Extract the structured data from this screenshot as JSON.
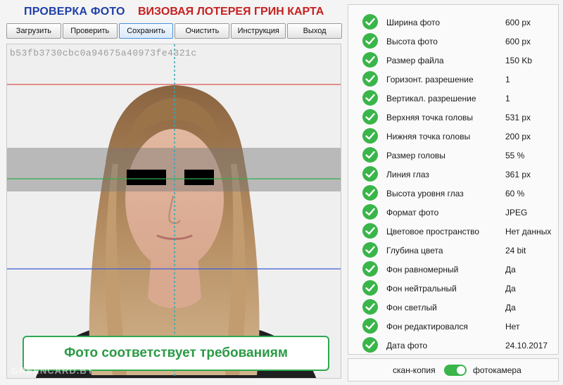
{
  "header": {
    "title_left": "ПРОВЕРКА ФОТО",
    "title_right": "ВИЗОВАЯ ЛОТЕРЕЯ ГРИН КАРТА"
  },
  "toolbar": {
    "buttons": [
      "Загрузить",
      "Проверить",
      "Сохранить",
      "Очистить",
      "Инструкция",
      "Выход"
    ],
    "active": "Сохранить"
  },
  "photo": {
    "hash": "b53fb3730cbc0a94675a40973fe4321c",
    "watermark": "GREENCARD.BY",
    "result": "Фото соответствует требованиям"
  },
  "checks": [
    {
      "label": "Ширина фото",
      "value": "600 px"
    },
    {
      "label": "Высота фото",
      "value": "600 px"
    },
    {
      "label": "Размер файла",
      "value": "150 Kb"
    },
    {
      "label": "Горизонт. разрешение",
      "value": "1"
    },
    {
      "label": "Вертикал. разрешение",
      "value": "1"
    },
    {
      "label": "Верхняя точка головы",
      "value": "531 px"
    },
    {
      "label": "Нижняя точка головы",
      "value": "200 px"
    },
    {
      "label": "Размер головы",
      "value": "55 %"
    },
    {
      "label": "Линия глаз",
      "value": "361 px"
    },
    {
      "label": "Высота уровня глаз",
      "value": "60 %"
    },
    {
      "label": "Формат фото",
      "value": "JPEG"
    },
    {
      "label": "Цветовое пространство",
      "value": "Нет данных"
    },
    {
      "label": "Глубина цвета",
      "value": "24 bit"
    },
    {
      "label": "Фон равномерный",
      "value": "Да"
    },
    {
      "label": "Фон нейтральный",
      "value": "Да"
    },
    {
      "label": "Фон светлый",
      "value": "Да"
    },
    {
      "label": "Фон редактировался",
      "value": "Нет"
    },
    {
      "label": "Дата фото",
      "value": "24.10.2017"
    }
  ],
  "mode": {
    "left_label": "скан-копия",
    "right_label": "фотокамера",
    "toggle_on": true
  },
  "colors": {
    "title_blue": "#1f3fa8",
    "title_red": "#c62020",
    "check_green": "#3ab54a",
    "top_line": "#d9534f",
    "eye_line": "#2fb14b",
    "chin_line": "#3b5fd9",
    "center_line": "#3aa6b9"
  }
}
